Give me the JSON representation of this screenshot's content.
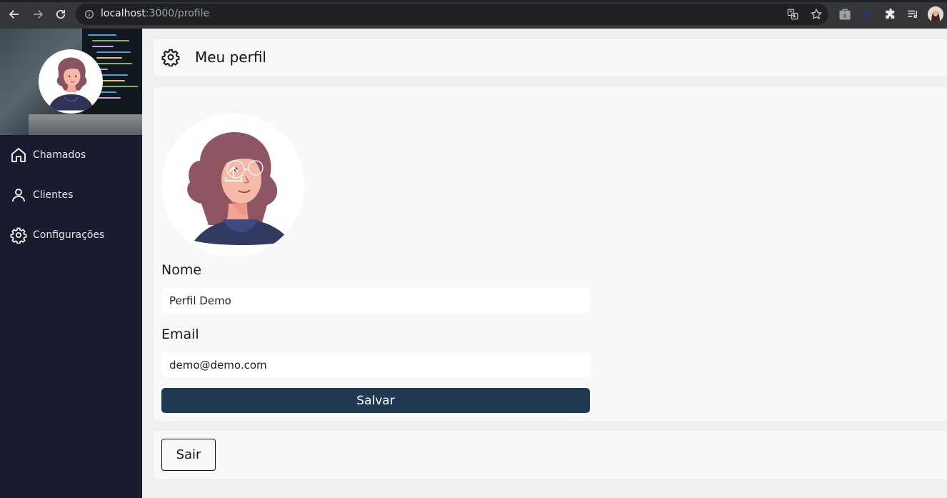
{
  "browser": {
    "url_host": "localhost",
    "url_rest": ":3000/profile",
    "icons": [
      "back-icon",
      "forward-icon",
      "reload-icon",
      "info-icon",
      "translate-icon",
      "star-icon",
      "extension-a-icon",
      "extension-shield-icon",
      "puzzle-icon",
      "reading-list-icon",
      "profile-avatar"
    ]
  },
  "sidebar": {
    "items": [
      {
        "label": "Chamados",
        "icon": "home-icon"
      },
      {
        "label": "Clientes",
        "icon": "user-icon"
      },
      {
        "label": "Configurações",
        "icon": "settings-icon"
      }
    ]
  },
  "header": {
    "title": "Meu perfil",
    "icon": "settings-icon"
  },
  "form": {
    "name_label": "Nome",
    "name_value": "Perfil Demo",
    "email_label": "Email",
    "email_value": "demo@demo.com",
    "save_label": "Salvar"
  },
  "logout": {
    "label": "Sair"
  },
  "colors": {
    "sidebar_bg": "#181c2e",
    "primary_button": "#1f3a52",
    "panel_bg": "#f8f8f8",
    "page_bg": "#efefef"
  }
}
